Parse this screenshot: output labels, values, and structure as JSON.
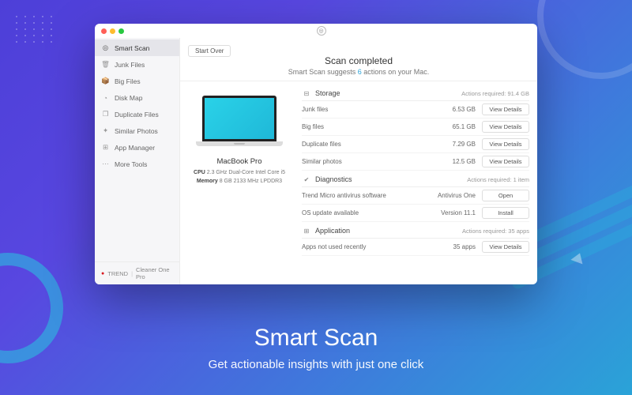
{
  "hero": {
    "title": "Smart Scan",
    "subtitle": "Get actionable insights with just one click"
  },
  "sidebar": {
    "items": [
      {
        "label": "Smart Scan",
        "icon": "◎",
        "active": true
      },
      {
        "label": "Junk Files",
        "icon": "🗑"
      },
      {
        "label": "Big Files",
        "icon": "📦"
      },
      {
        "label": "Disk Map",
        "icon": "◔"
      },
      {
        "label": "Duplicate Files",
        "icon": "❐"
      },
      {
        "label": "Similar Photos",
        "icon": "✦"
      },
      {
        "label": "App Manager",
        "icon": "⊞"
      },
      {
        "label": "More Tools",
        "icon": "⋯"
      }
    ],
    "footer": {
      "brand": "TREND",
      "product": "Cleaner One Pro"
    }
  },
  "main": {
    "start_over": "Start Over",
    "title": "Scan completed",
    "subtitle_prefix": "Smart Scan suggests ",
    "actions_count": "6",
    "subtitle_suffix": " actions on your Mac."
  },
  "device": {
    "name": "MacBook Pro",
    "cpu_label": "CPU",
    "cpu": "2.3 GHz Dual-Core Intel Core i5",
    "mem_label": "Memory",
    "mem": "8 GB 2133 MHz LPDDR3"
  },
  "sections": [
    {
      "title": "Storage",
      "icon": "⊟",
      "meta": "Actions required: 91.4 GB",
      "rows": [
        {
          "name": "Junk files",
          "val": "6.53 GB",
          "btn": "View Details"
        },
        {
          "name": "Big files",
          "val": "65.1 GB",
          "btn": "View Details"
        },
        {
          "name": "Duplicate files",
          "val": "7.29 GB",
          "btn": "View Details"
        },
        {
          "name": "Similar photos",
          "val": "12.5 GB",
          "btn": "View Details"
        }
      ]
    },
    {
      "title": "Diagnostics",
      "icon": "✔",
      "meta": "Actions required: 1 item",
      "rows": [
        {
          "name": "Trend Micro antivirus software",
          "val": "Antivirus One",
          "btn": "Open"
        },
        {
          "name": "OS update available",
          "val": "Version 11.1",
          "btn": "Install"
        }
      ]
    },
    {
      "title": "Application",
      "icon": "⊞",
      "meta": "Actions required: 35 apps",
      "rows": [
        {
          "name": "Apps not used recently",
          "val": "35 apps",
          "btn": "View Details"
        }
      ]
    }
  ]
}
